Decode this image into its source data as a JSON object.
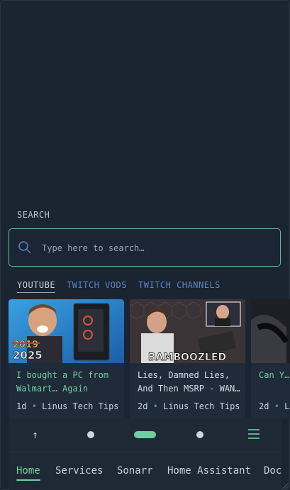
{
  "search": {
    "title": "SEARCH",
    "placeholder": "Type here to search…"
  },
  "tabs": [
    {
      "label": "YOUTUBE",
      "active": true
    },
    {
      "label": "TWITCH VODS",
      "active": false
    },
    {
      "label": "TWITCH CHANNELS",
      "active": false
    }
  ],
  "videos": [
    {
      "title": "I bought a PC from Walmart… Again",
      "age": "1d",
      "channel": "Linus Tech Tips",
      "thumb_text_top": "2019",
      "thumb_text_bottom": "2025"
    },
    {
      "title": "Lies, Damned Lies, And Then MSRP - WAN…",
      "age": "2d",
      "channel": "Linus Tech Tips",
      "thumb_text": "BAMBOOZLED"
    },
    {
      "title": "Can Y… Impo…",
      "age": "2d",
      "channel": "L"
    }
  ],
  "pager": {
    "pages": 4,
    "active_index": 1
  },
  "nav": [
    "Home",
    "Services",
    "Sonarr",
    "Home Assistant",
    "Doc"
  ],
  "colors": {
    "accent": "#6fcf9f",
    "link": "#5b86c0",
    "background": "#1b2431"
  }
}
